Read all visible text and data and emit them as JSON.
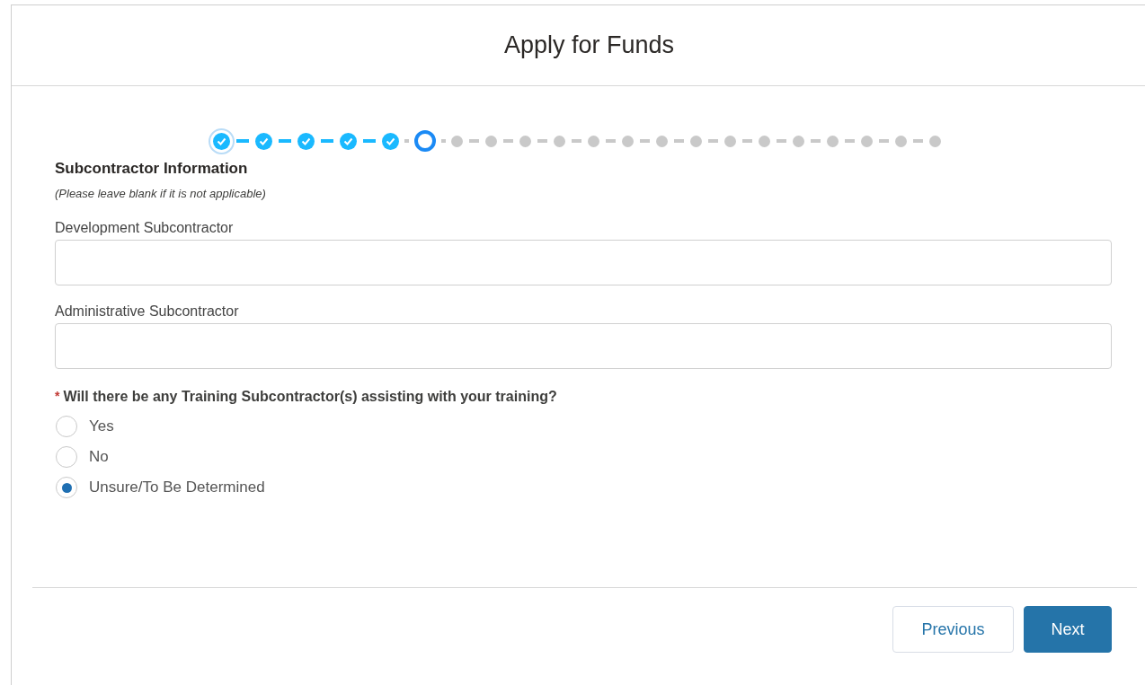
{
  "window": {
    "title": "Apply for Funds"
  },
  "progress": {
    "steps": [
      {
        "completed": true,
        "current": false,
        "focused": true
      },
      {
        "completed": true,
        "current": false,
        "focused": false
      },
      {
        "completed": true,
        "current": false,
        "focused": false
      },
      {
        "completed": true,
        "current": false,
        "focused": false
      },
      {
        "completed": true,
        "current": false,
        "focused": false
      },
      {
        "completed": false,
        "current": true,
        "focused": false
      },
      {
        "completed": false,
        "current": false,
        "focused": false
      },
      {
        "completed": false,
        "current": false,
        "focused": false
      },
      {
        "completed": false,
        "current": false,
        "focused": false
      },
      {
        "completed": false,
        "current": false,
        "focused": false
      },
      {
        "completed": false,
        "current": false,
        "focused": false
      },
      {
        "completed": false,
        "current": false,
        "focused": false
      },
      {
        "completed": false,
        "current": false,
        "focused": false
      },
      {
        "completed": false,
        "current": false,
        "focused": false
      },
      {
        "completed": false,
        "current": false,
        "focused": false
      },
      {
        "completed": false,
        "current": false,
        "focused": false
      },
      {
        "completed": false,
        "current": false,
        "focused": false
      },
      {
        "completed": false,
        "current": false,
        "focused": false
      },
      {
        "completed": false,
        "current": false,
        "focused": false
      },
      {
        "completed": false,
        "current": false,
        "focused": false
      },
      {
        "completed": false,
        "current": false,
        "focused": false
      }
    ]
  },
  "section": {
    "title": "Subcontractor Information",
    "note": "(Please leave blank if it is not applicable)"
  },
  "fields": [
    {
      "label": "Development Subcontractor"
    },
    {
      "label": "Administrative Subcontractor"
    }
  ],
  "question": {
    "required_mark": "*",
    "label": "Will there be any Training Subcontractor(s) assisting with your training?",
    "options": [
      {
        "label": "Yes",
        "selected": false
      },
      {
        "label": "No",
        "selected": false
      },
      {
        "label": "Unsure/To Be Determined",
        "selected": true
      }
    ]
  },
  "buttons": [
    {
      "label": "Previous",
      "kind": "neutral"
    },
    {
      "label": "Next",
      "kind": "brand"
    }
  ]
}
